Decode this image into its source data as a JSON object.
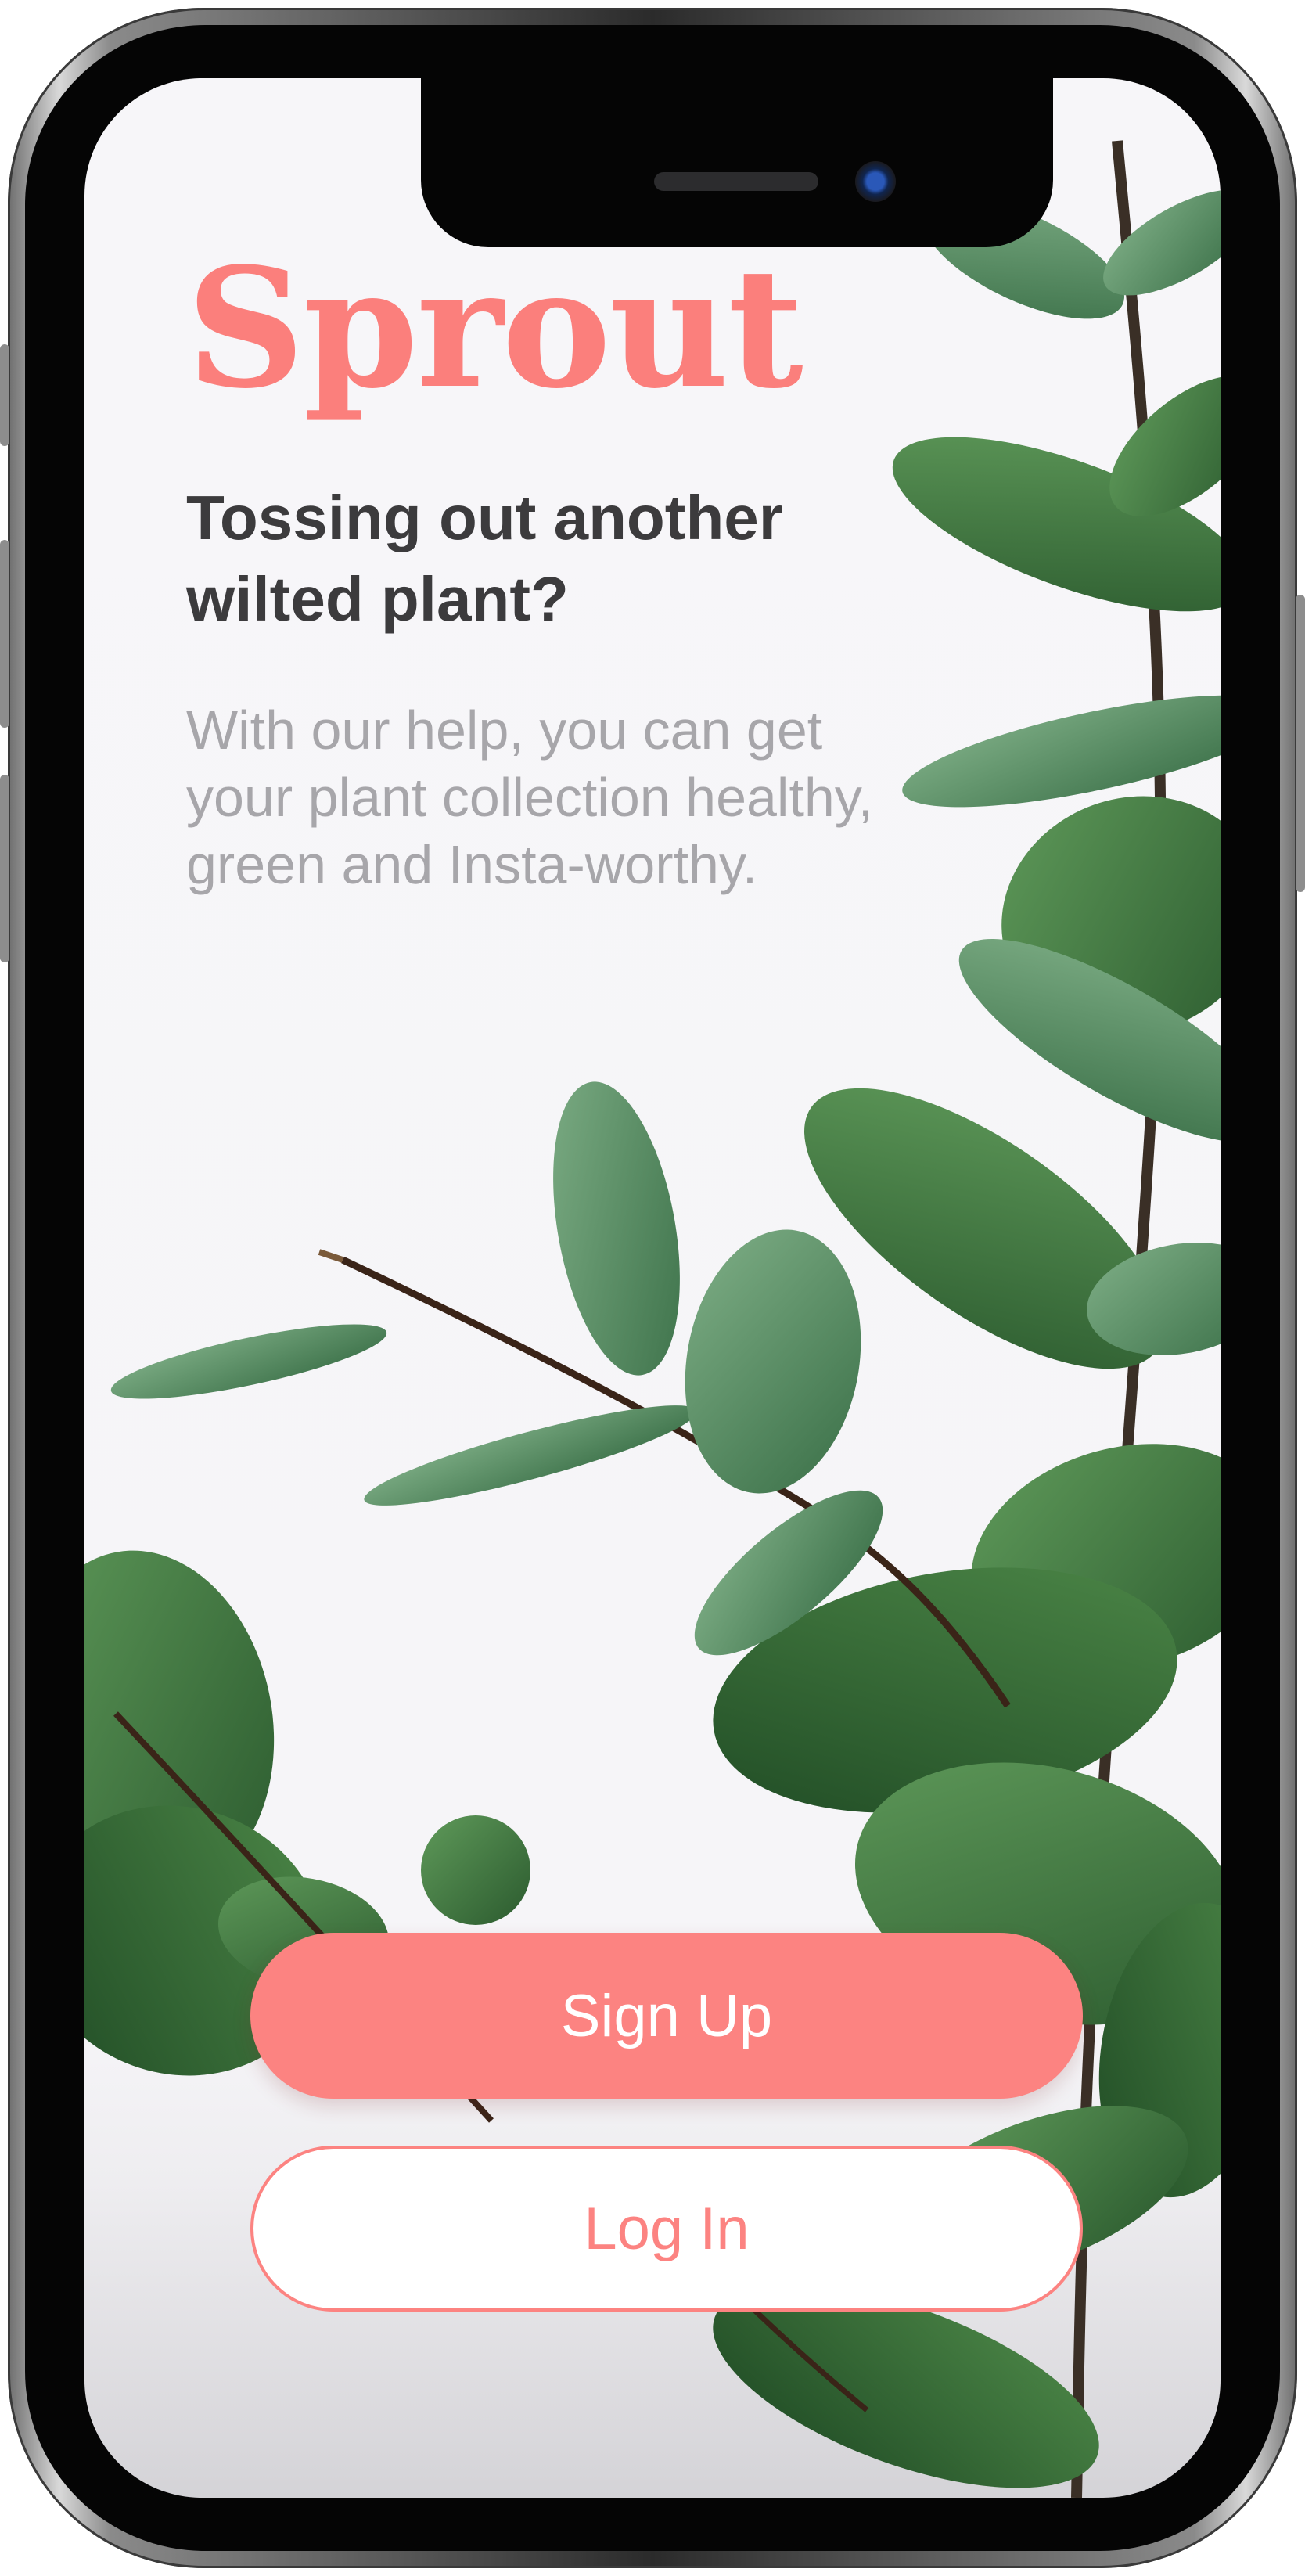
{
  "app": {
    "brand_name": "Sprout",
    "headline": "Tossing out another wilted plant?",
    "description": "With our help, you can get your plant collection healthy, green and Insta-worthy."
  },
  "actions": {
    "signup_label": "Sign Up",
    "login_label": "Log In"
  },
  "colors": {
    "brand": "#fb7f7c",
    "headline": "#3c3b3d",
    "body_text": "#a7a6aa",
    "background": "#f7f6f9",
    "leaf": "#3f7a4f"
  },
  "decor": {
    "background_image": "eucalyptus-plant-icon"
  }
}
